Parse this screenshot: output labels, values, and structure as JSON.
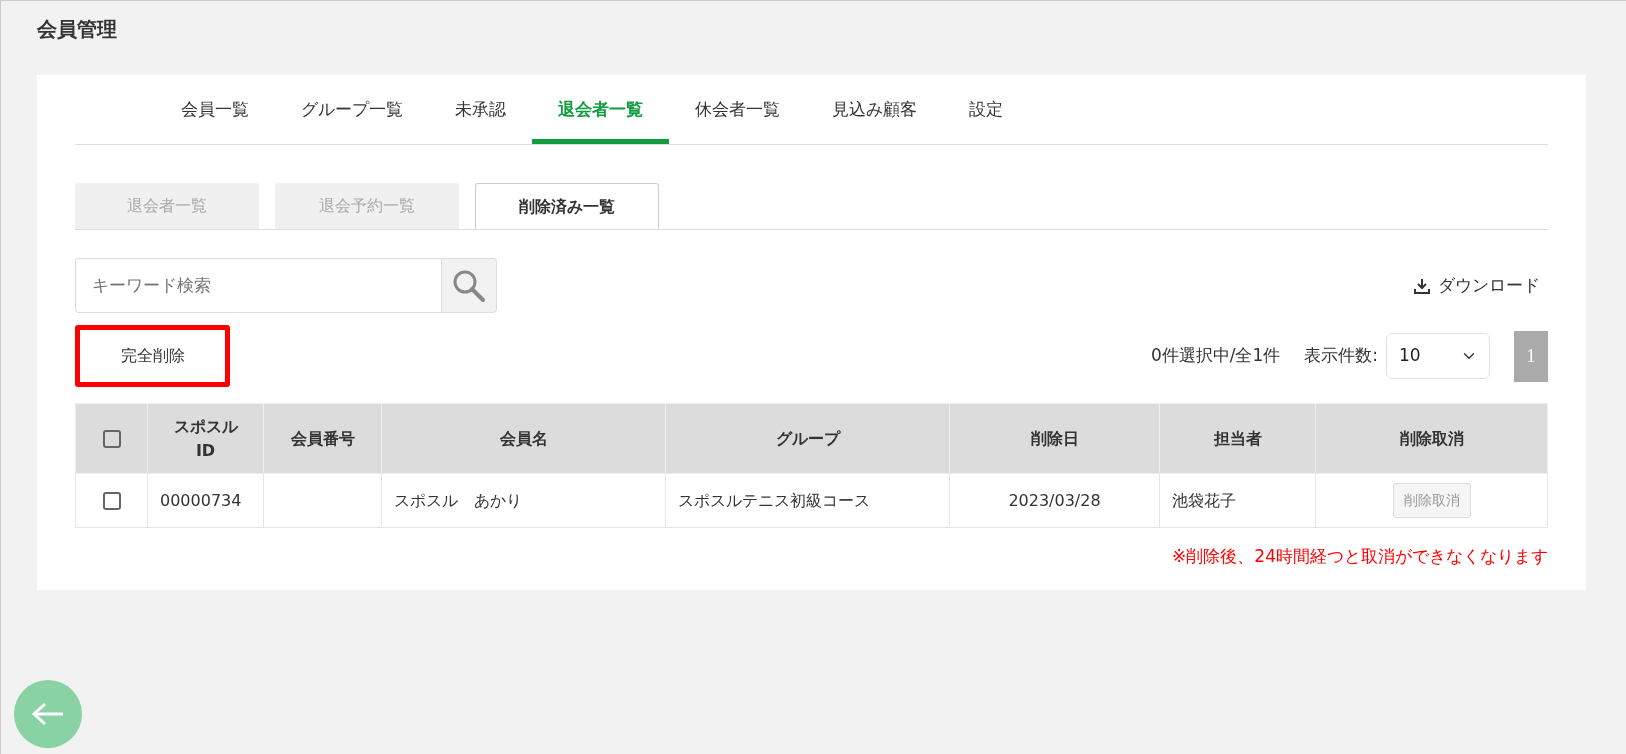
{
  "page_title": "会員管理",
  "tabs": [
    {
      "label": "会員一覧",
      "selected": false
    },
    {
      "label": "グループ一覧",
      "selected": false
    },
    {
      "label": "未承認",
      "selected": false
    },
    {
      "label": "退会者一覧",
      "selected": true
    },
    {
      "label": "休会者一覧",
      "selected": false
    },
    {
      "label": "見込み顧客",
      "selected": false
    },
    {
      "label": "設定",
      "selected": false
    }
  ],
  "subtabs": [
    {
      "label": "退会者一覧",
      "selected": false
    },
    {
      "label": "退会予約一覧",
      "selected": false
    },
    {
      "label": "削除済み一覧",
      "selected": true
    }
  ],
  "search": {
    "placeholder": "キーワード検索"
  },
  "download": {
    "label": "ダウンロード"
  },
  "delete_button": {
    "label": "完全削除",
    "highlighted": true
  },
  "selection_count": "0件選択中/全1件",
  "page_size": {
    "label": "表示件数:",
    "value": "10"
  },
  "pagination": [
    {
      "label": "1",
      "selected": true
    }
  ],
  "table": {
    "select_all_checked": false,
    "columns": [
      "スポスル ID",
      "会員番号",
      "会員名",
      "グループ",
      "削除日",
      "担当者",
      "削除取消"
    ],
    "rows": [
      {
        "checked": false,
        "cells": [
          "00000734",
          "",
          "スポスル　あかり",
          "スポスルテニス初級コース",
          "2023/03/28",
          "池袋花子"
        ],
        "action": "削除取消"
      }
    ]
  },
  "note": "※削除後、24時間経つと取消ができなくなります"
}
